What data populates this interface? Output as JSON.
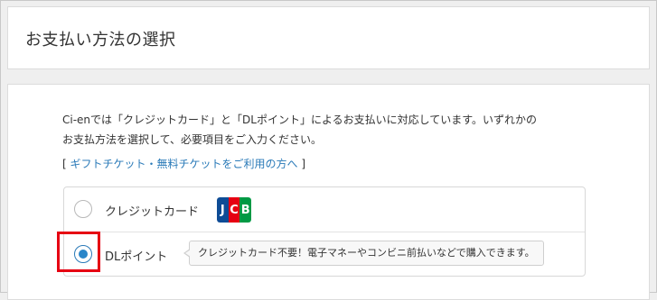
{
  "header": {
    "title": "お支払い方法の選択"
  },
  "intro": {
    "line1": "Ci-enでは「クレジットカード」と「DLポイント」によるお支払いに対応しています。いずれかの",
    "line2": "お支払方法を選択して、必要項目をご入力ください。"
  },
  "gift_link": {
    "open": "[ ",
    "label": "ギフトチケット・無料チケットをご利用の方へ",
    "close": " ]"
  },
  "payment_options": {
    "credit": {
      "label": "クレジットカード",
      "selected": false,
      "logo_text": [
        "J",
        "C",
        "B"
      ]
    },
    "dl": {
      "label": "DLポイント",
      "selected": true,
      "tooltip": "クレジットカード不要！電子マネーやコンビニ前払いなどで購入できます。"
    }
  },
  "colors": {
    "accent": "#2a86c9",
    "link": "#2a7ab8",
    "highlight": "#e60012"
  }
}
